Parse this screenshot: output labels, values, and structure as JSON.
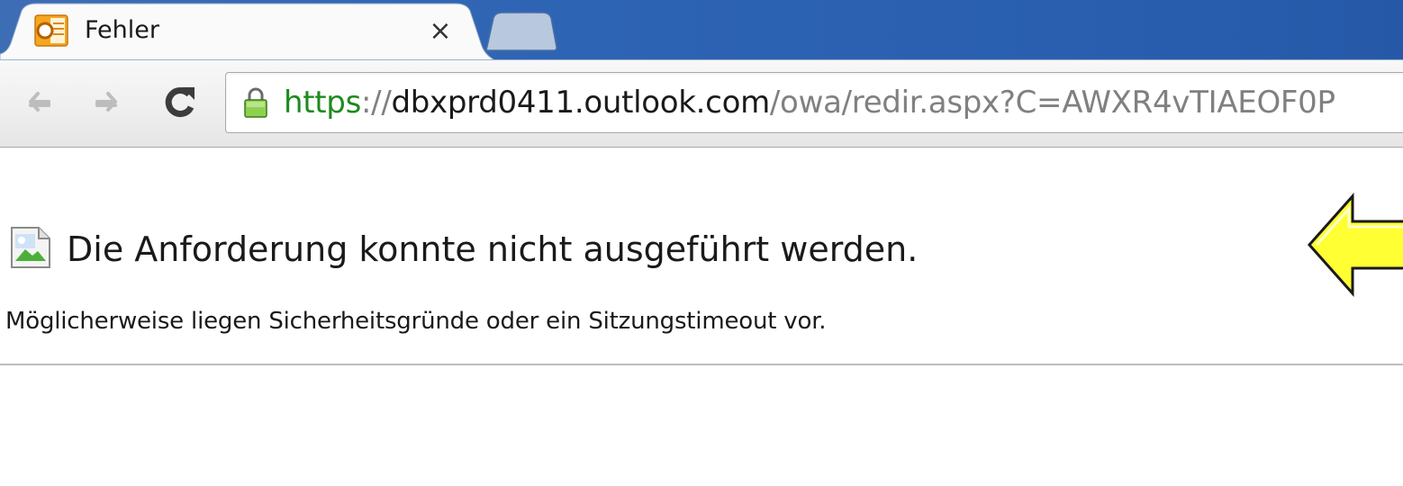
{
  "browser": {
    "active_tab": {
      "title": "Fehler",
      "close_glyph": "×",
      "favicon": "outlook-icon"
    },
    "new_tab_icon": "new-tab-icon",
    "nav": {
      "back_icon": "arrow-left-icon",
      "forward_icon": "arrow-right-icon",
      "reload_icon": "reload-icon"
    },
    "address_bar": {
      "secure_icon": "lock-icon",
      "scheme": "https",
      "separator": "://",
      "host": "dbxprd0411.outlook.com",
      "path": "/owa/redir.aspx?C=AWXR4vTIAEOF0P"
    }
  },
  "page": {
    "heading": "Die Anforderung konnte nicht ausgeführt werden.",
    "message": "Möglicherweise liegen Sicherheitsgründe oder ein Sitzungstimeout vor.",
    "heading_icon": "broken-image-icon"
  },
  "annotation": {
    "arrow_icon": "yellow-arrow-left-icon",
    "arrow_color": "#ffff33"
  },
  "colors": {
    "tabstrip": "#2e64b4",
    "url_scheme": "#1e8a1e",
    "url_host": "#1a1a1a",
    "url_path": "#808080"
  }
}
